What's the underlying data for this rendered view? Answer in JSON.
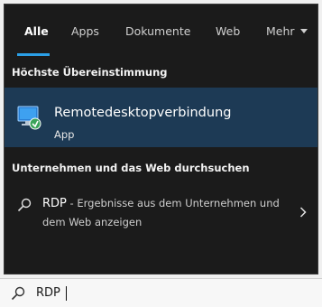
{
  "tabs": [
    {
      "label": "Alle",
      "active": true
    },
    {
      "label": "Apps",
      "active": false
    },
    {
      "label": "Dokumente",
      "active": false
    },
    {
      "label": "Web",
      "active": false
    },
    {
      "label": "Mehr",
      "active": false
    }
  ],
  "best_match": {
    "header": "Höchste Übereinstimmung",
    "title": "Remotedesktopverbindung",
    "subtitle": "App",
    "icon": "remote-desktop-icon"
  },
  "web_section": {
    "header": "Unternehmen und das Web durchsuchen",
    "term": "RDP",
    "description": " - Ergebnisse aus dem Unternehmen und dem Web anzeigen",
    "icon": "search-icon"
  },
  "search": {
    "value": "RDP"
  },
  "colors": {
    "panel_bg": "#1b1b1b",
    "selection_bg": "#1d3a55",
    "accent": "#2b9fe6"
  }
}
